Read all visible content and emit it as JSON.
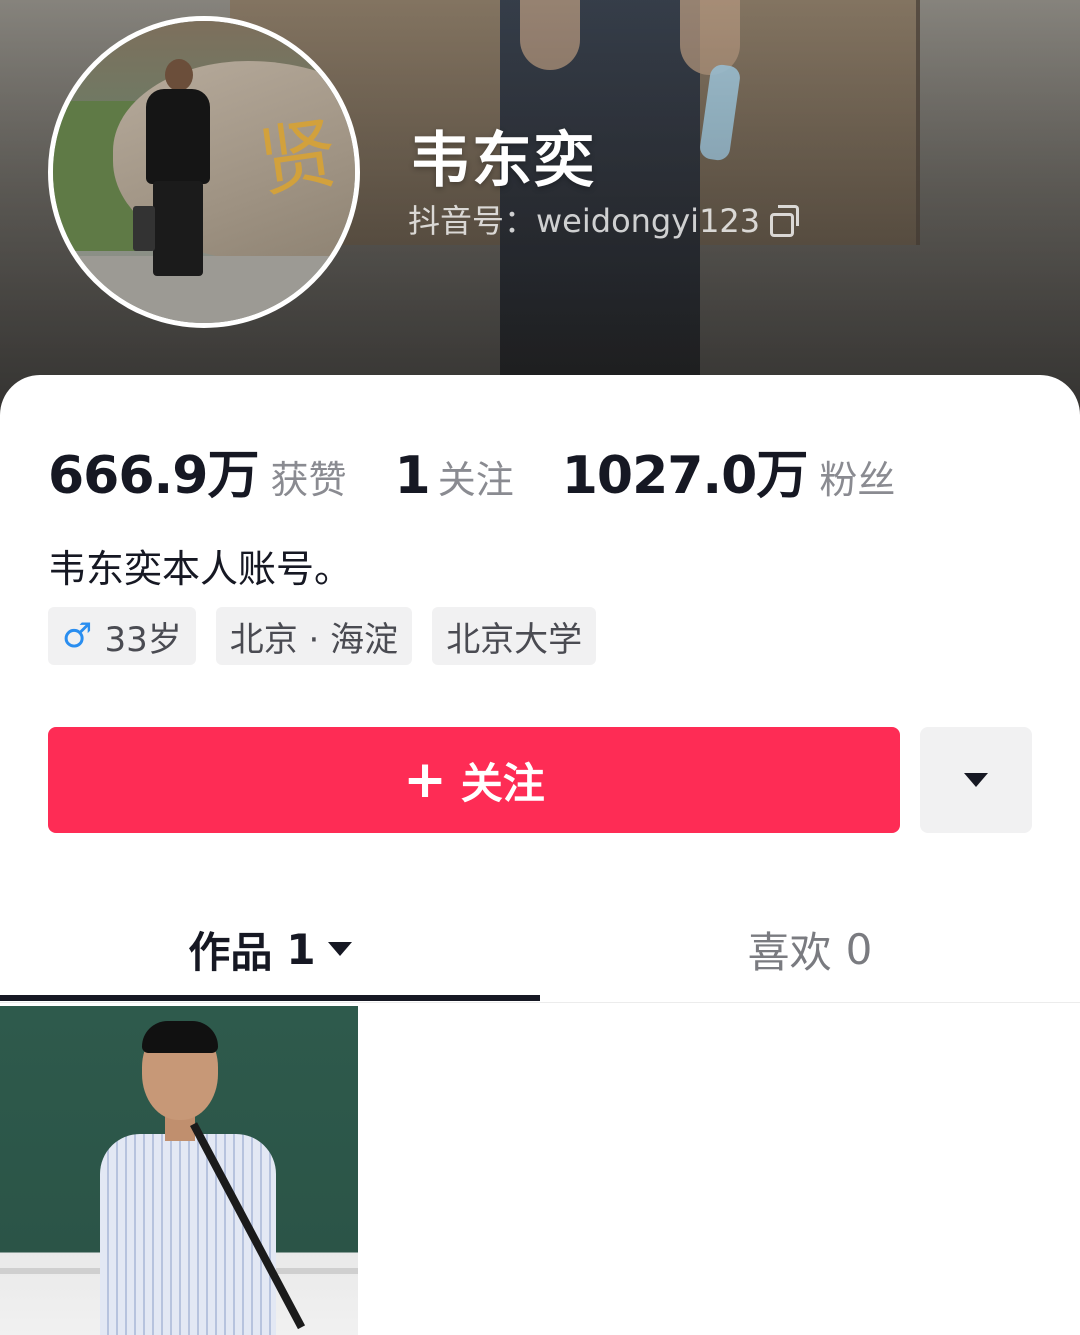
{
  "profile": {
    "name": "韦东奕",
    "handle_label": "抖音号：weidongyi123",
    "bio": "韦东奕本人账号。"
  },
  "banner": {
    "avatar_rock_char": "贤"
  },
  "stats": [
    {
      "value": "666.9万",
      "label": "获赞"
    },
    {
      "value": "1",
      "label": "关注"
    },
    {
      "value": "1027.0万",
      "label": "粉丝"
    }
  ],
  "tags": {
    "gender_symbol": "♂",
    "age": "33岁",
    "location": "北京 · 海淀",
    "school": "北京大学"
  },
  "actions": {
    "follow_plus": "+",
    "follow_label": "关注"
  },
  "tabs": {
    "works_label": "作品",
    "works_count": "1",
    "likes_label": "喜欢",
    "likes_count": "0"
  },
  "colors": {
    "follow_button": "#fe2c55",
    "text_primary": "#161823",
    "text_secondary": "#8a8b91",
    "tag_background": "#f1f1f2",
    "male_icon": "#2a8ef0"
  },
  "icons": {
    "copy": "copy-icon",
    "gender": "male-icon",
    "more": "caret-down-icon",
    "tab_dropdown": "caret-down-icon"
  }
}
